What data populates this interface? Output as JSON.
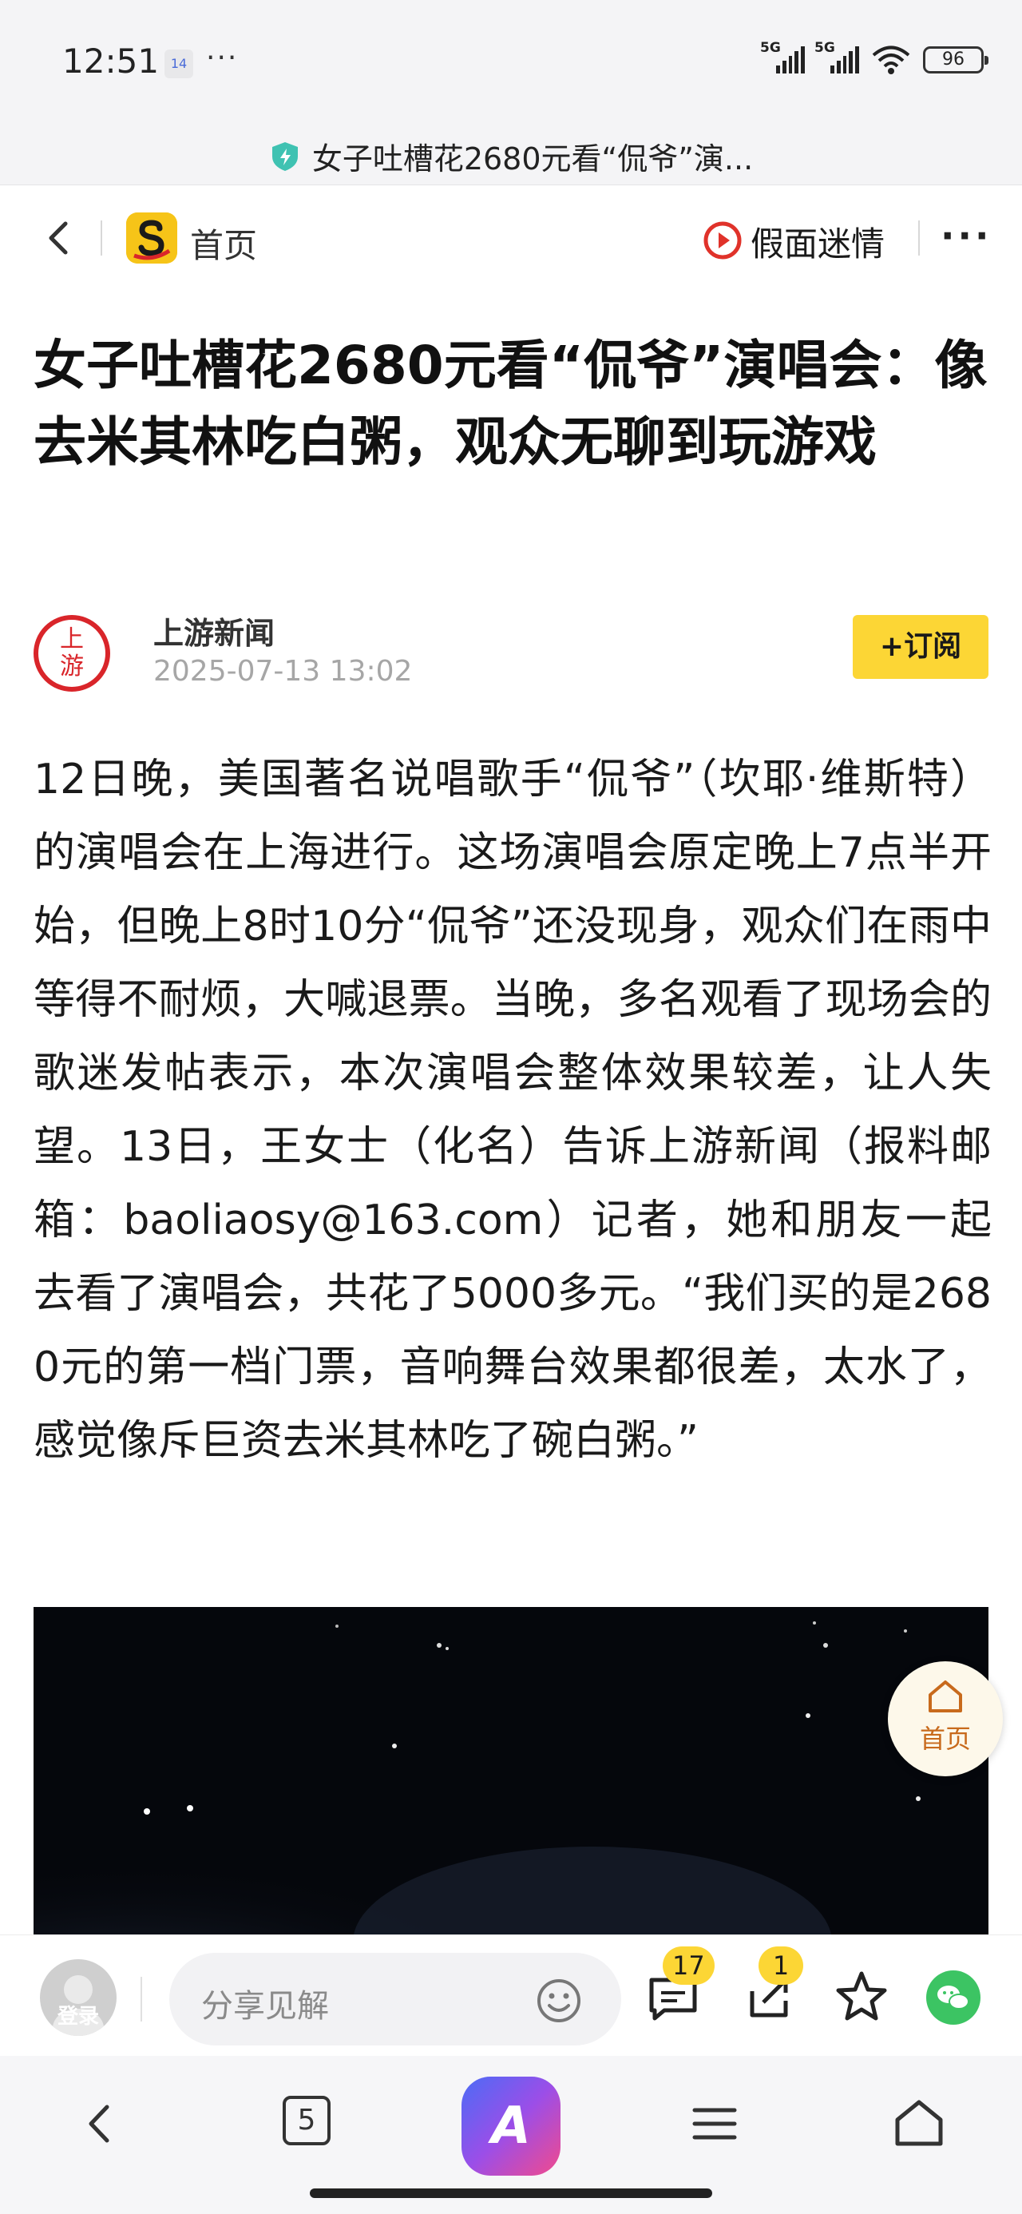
{
  "status_bar": {
    "time": "12:51",
    "notification_badge": "14",
    "more_indicator": "···",
    "signal_1_label": "5G",
    "signal_2_label": "5G",
    "battery": "96",
    "icons": [
      "signal-icon",
      "wifi-icon",
      "battery-icon"
    ]
  },
  "url_bar": {
    "title": "女子吐槽花2680元看“侃爷”演..."
  },
  "nav": {
    "home_label": "首页",
    "channel_name": "假面迷情",
    "more_label": "···"
  },
  "article": {
    "headline": "女子吐槽花2680元看“侃爷”演唱会：像去米其林吃白粥，观众无聊到玩游戏",
    "author_logo_text": "上游",
    "author": "上游新闻",
    "published": "2025-07-13 13:02",
    "subscribe_label": "+订阅",
    "body": "12日晚，美国著名说唱歌手“侃爷”（坎耶·维斯特）的演唱会在上海进行。这场演唱会原定晚上7点半开始，但晚上8时10分“侃爷”还没现身，观众们在雨中等得不耐烦，大喊退票。当晚，多名观看了现场会的歌迷发帖表示，本次演唱会整体效果较差，让人失望。13日，王女士（化名）告诉上游新闻（报料邮箱：baoliaosy@163.com）记者，她和朋友一起去看了演唱会，共花了5000多元。“我们买的是2680元的第一档门票，音响舞台效果都很差，太水了，感觉像斥巨资去米其林吃了碗白粥。”"
  },
  "floating_home": {
    "label": "首页"
  },
  "comment_bar": {
    "login_label": "登录",
    "placeholder": "分享见解",
    "comment_count": "17",
    "share_count": "1"
  },
  "bottom_nav": {
    "tab_count": "5",
    "ai_label": "A"
  },
  "colors": {
    "accent_yellow": "#fcd635",
    "brand_red": "#d9252a",
    "wechat_green": "#3cc463"
  }
}
